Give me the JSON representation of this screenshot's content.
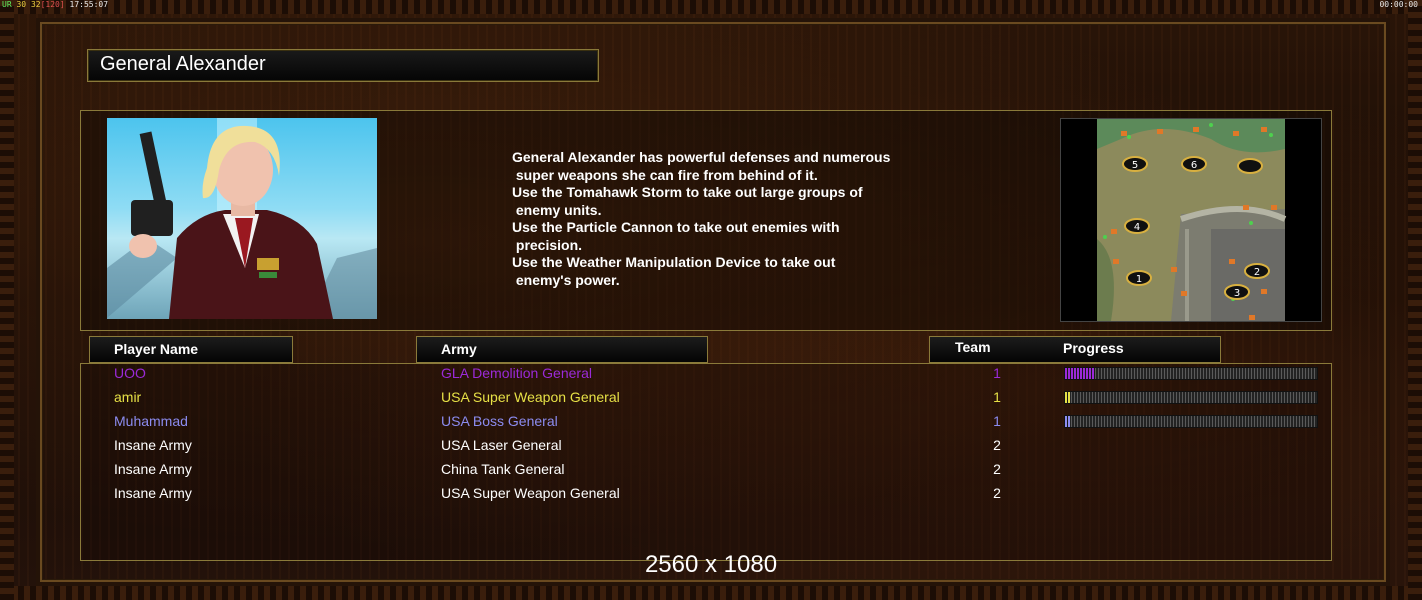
{
  "hud": {
    "left_prefix": "UR",
    "fps": "30",
    "fps_target": "32",
    "fps_cap": "[120]",
    "time": "17:55:07",
    "right_clock": "00:00:00"
  },
  "general": {
    "title": "General Alexander",
    "description_lines": [
      "General Alexander has powerful defenses and numerous",
      " super weapons she can fire from behind of it.",
      "Use the Tomahawk Storm to take out large groups of",
      " enemy units.",
      "Use the Particle Cannon to take out enemies with",
      " precision.",
      "Use the Weather Manipulation Device to take out",
      " enemy's power."
    ]
  },
  "minimap": {
    "slots": [
      "5",
      "6",
      "4",
      "1",
      "2",
      "3"
    ]
  },
  "table": {
    "headers": {
      "player": "Player Name",
      "army": "Army",
      "team": "Team",
      "progress": "Progress"
    },
    "rows": [
      {
        "name": "UOO",
        "army": "GLA Demolition General",
        "team": "1",
        "color": "#9a2ad8",
        "progress": 0.12,
        "has_progress": true
      },
      {
        "name": "amir",
        "army": "USA Super Weapon General",
        "team": "1",
        "color": "#e6e046",
        "progress": 0.02,
        "has_progress": true
      },
      {
        "name": "Muhammad",
        "army": "USA Boss General",
        "team": "1",
        "color": "#8c8cf0",
        "progress": 0.02,
        "has_progress": true
      },
      {
        "name": "Insane Army",
        "army": "USA Laser General",
        "team": "2",
        "color": "#ffffff",
        "progress": 0,
        "has_progress": false
      },
      {
        "name": "Insane Army",
        "army": "China Tank General",
        "team": "2",
        "color": "#ffffff",
        "progress": 0,
        "has_progress": false
      },
      {
        "name": "Insane Army",
        "army": "USA Super Weapon General",
        "team": "2",
        "color": "#ffffff",
        "progress": 0,
        "has_progress": false
      }
    ]
  },
  "resolution_label": "2560 x 1080"
}
